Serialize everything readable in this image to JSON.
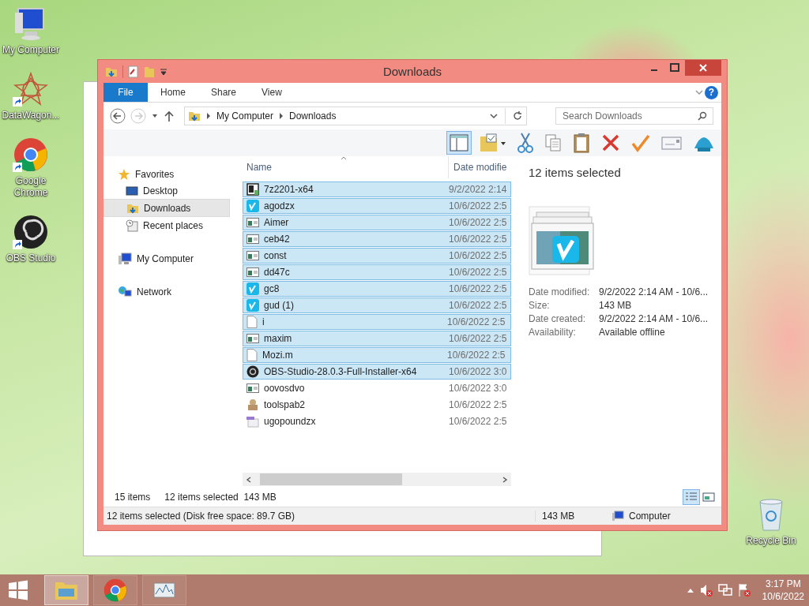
{
  "desktop_icons": [
    {
      "label": "My Computer",
      "kind": "computer",
      "shortcut": false
    },
    {
      "label": "DataWagon...",
      "kind": "star",
      "shortcut": true
    },
    {
      "label": "Google Chrome",
      "kind": "chrome",
      "shortcut": true
    },
    {
      "label": "OBS Studio",
      "kind": "obs",
      "shortcut": true
    }
  ],
  "recycle_bin": {
    "label": "Recycle Bin"
  },
  "window": {
    "title": "Downloads",
    "ribbon_tabs": [
      {
        "label": "File",
        "kind": "file",
        "selected": false
      },
      {
        "label": "Home",
        "kind": "tab",
        "selected": false
      },
      {
        "label": "Share",
        "kind": "tab",
        "selected": false
      },
      {
        "label": "View",
        "kind": "tab",
        "selected": false
      }
    ],
    "help": "?",
    "breadcrumbs": [
      "My Computer",
      "Downloads"
    ],
    "search": {
      "placeholder": "Search Downloads"
    },
    "toolbar": [
      {
        "kind": "preview-pane",
        "on": true
      },
      {
        "kind": "folder-options",
        "on": false
      },
      {
        "kind": "cut",
        "on": false
      },
      {
        "kind": "copy",
        "on": false
      },
      {
        "kind": "paste",
        "on": false
      },
      {
        "kind": "delete",
        "on": false
      },
      {
        "kind": "check",
        "on": false
      },
      {
        "kind": "envelope",
        "on": false
      },
      {
        "kind": "shell",
        "on": false
      }
    ],
    "navigation": [
      {
        "label": "Favorites",
        "kind": "star",
        "selected": false,
        "children": [
          {
            "label": "Desktop",
            "kind": "desktop",
            "selected": false
          },
          {
            "label": "Downloads",
            "kind": "downloads",
            "selected": true
          },
          {
            "label": "Recent places",
            "kind": "recent",
            "selected": false
          }
        ]
      },
      {
        "label": "My Computer",
        "kind": "computer",
        "selected": false
      },
      {
        "label": "Network",
        "kind": "network",
        "selected": false
      }
    ],
    "columns": [
      "Name",
      "Date modifie"
    ],
    "files": [
      {
        "name": "7z2201-x64",
        "date": "9/2/2022 2:14",
        "kind": "archive",
        "selected": true
      },
      {
        "name": "agodzx",
        "date": "10/6/2022 2:5",
        "kind": "vimeo",
        "selected": true
      },
      {
        "name": "Aimer",
        "date": "10/6/2022 2:5",
        "kind": "window",
        "selected": true
      },
      {
        "name": "ceb42",
        "date": "10/6/2022 2:5",
        "kind": "window",
        "selected": true
      },
      {
        "name": "const",
        "date": "10/6/2022 2:5",
        "kind": "window",
        "selected": true
      },
      {
        "name": "dd47c",
        "date": "10/6/2022 2:5",
        "kind": "window",
        "selected": true
      },
      {
        "name": "gc8",
        "date": "10/6/2022 2:5",
        "kind": "vimeo",
        "selected": true
      },
      {
        "name": "gud (1)",
        "date": "10/6/2022 2:5",
        "kind": "vimeo",
        "selected": true
      },
      {
        "name": "i",
        "date": "10/6/2022 2:5",
        "kind": "blank",
        "selected": true
      },
      {
        "name": "maxim",
        "date": "10/6/2022 2:5",
        "kind": "window",
        "selected": true
      },
      {
        "name": "Mozi.m",
        "date": "10/6/2022 2:5",
        "kind": "blank",
        "selected": true
      },
      {
        "name": "OBS-Studio-28.0.3-Full-Installer-x64",
        "date": "10/6/2022 3:0",
        "kind": "obs",
        "selected": true
      },
      {
        "name": "oovosdvo",
        "date": "10/6/2022 3:0",
        "kind": "window",
        "selected": false
      },
      {
        "name": "toolspab2",
        "date": "10/6/2022 2:5",
        "kind": "package",
        "selected": false
      },
      {
        "name": "ugopoundzx",
        "date": "10/6/2022 2:5",
        "kind": "media",
        "selected": false
      }
    ],
    "details": {
      "title": "12 items selected",
      "properties": [
        {
          "label": "Date modified:",
          "value": "9/2/2022 2:14 AM - 10/6..."
        },
        {
          "label": "Size:",
          "value": "143 MB"
        },
        {
          "label": "Date created:",
          "value": "9/2/2022 2:14 AM - 10/6..."
        },
        {
          "label": "Availability:",
          "value": "Available offline"
        }
      ]
    },
    "item_count": "15 items",
    "selection_info": "12 items selected  143 MB",
    "views": [
      {
        "kind": "details",
        "selected": true
      },
      {
        "kind": "thumbnails",
        "selected": false
      }
    ],
    "status_bar": {
      "summary": "12 items selected (Disk free space: 89.7 GB)",
      "size": "143 MB",
      "zone": "Computer"
    }
  },
  "taskbar": {
    "apps": [
      {
        "kind": "explorer",
        "active": true
      },
      {
        "kind": "chrome",
        "active": false
      },
      {
        "kind": "monitor",
        "active": false
      }
    ],
    "time": "3:17 PM",
    "date": "10/6/2022"
  }
}
